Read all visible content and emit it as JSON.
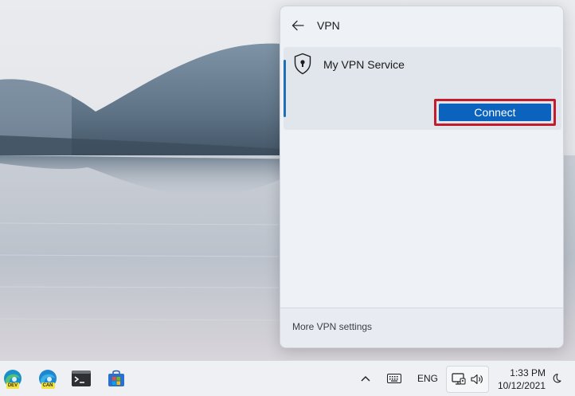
{
  "flyout": {
    "title": "VPN",
    "back_icon": "arrow-left-icon",
    "vpn_item": {
      "name": "My VPN Service",
      "icon": "shield-lock-icon",
      "connect_label": "Connect"
    },
    "more_settings_label": "More VPN settings"
  },
  "taskbar": {
    "apps": [
      {
        "name": "edge-dev-icon",
        "badge": "DEV"
      },
      {
        "name": "edge-canary-icon",
        "badge": "CAN"
      },
      {
        "name": "terminal-icon"
      },
      {
        "name": "store-icon"
      }
    ],
    "tray": {
      "chevron_icon": "chevron-up-icon",
      "keyboard_icon": "keyboard-icon",
      "language": "ENG",
      "network_icon": "network-icon",
      "volume_icon": "volume-icon",
      "focus_icon": "moon-icon"
    },
    "clock": {
      "time": "1:33 PM",
      "date": "10/12/2021"
    }
  },
  "colors": {
    "accent": "#0b63be",
    "highlight": "#c21d2d",
    "flyout_bg": "#eef1f6"
  }
}
